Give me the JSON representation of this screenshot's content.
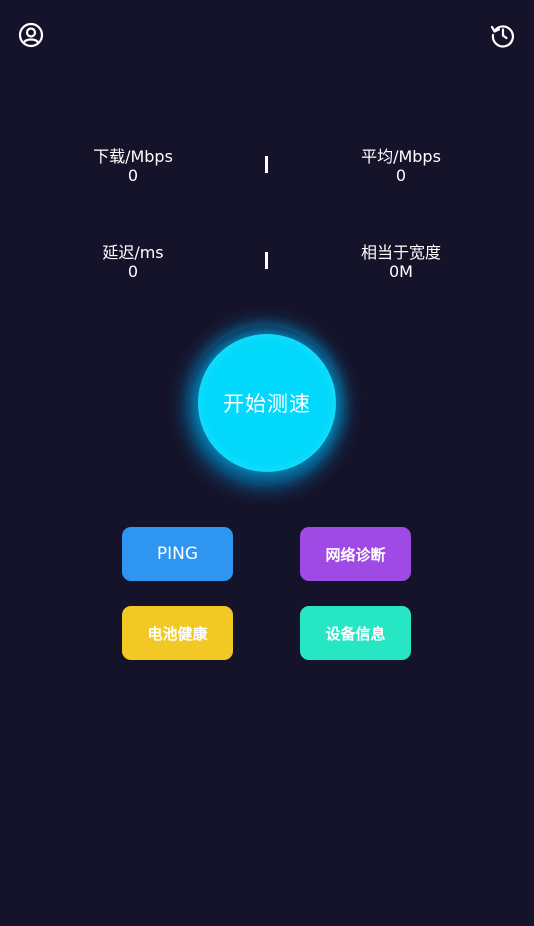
{
  "header": {
    "left_icon": "user-circle-icon",
    "right_icon": "history-icon"
  },
  "stats": {
    "download": {
      "label": "下载/Mbps",
      "value": "0"
    },
    "average": {
      "label": "平均/Mbps",
      "value": "0"
    },
    "latency": {
      "label": "延迟/ms",
      "value": "0"
    },
    "bandwidth": {
      "label": "相当于宽度",
      "value": "0M"
    }
  },
  "start_button": {
    "label": "开始测速"
  },
  "tools": {
    "ping": {
      "label": "PING"
    },
    "diagnose": {
      "label": "网络诊断"
    },
    "battery": {
      "label": "电池健康"
    },
    "device": {
      "label": "设备信息"
    }
  },
  "colors": {
    "background": "#15132a",
    "start": "#00d9fb",
    "ping": "#2e95f0",
    "diagnose": "#a04ae6",
    "battery": "#f2c825",
    "device": "#27e6c4"
  }
}
